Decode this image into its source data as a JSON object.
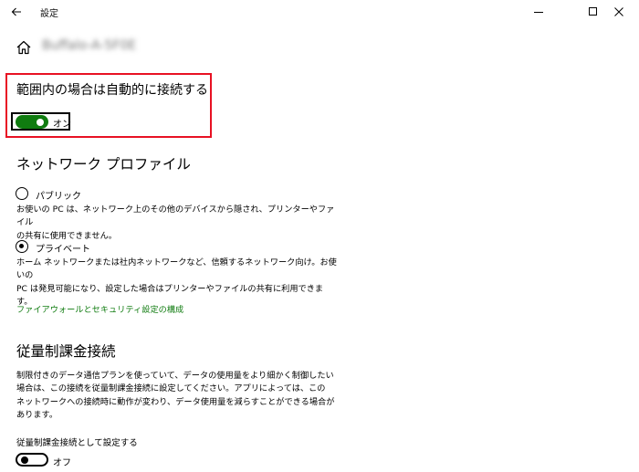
{
  "window": {
    "title": "設定",
    "back_icon": "back-arrow-icon",
    "minimize_icon": "minimize-icon",
    "maximize_icon": "maximize-icon",
    "close_icon": "close-icon"
  },
  "header": {
    "home_icon": "home-icon",
    "network_name": "Buffalo-A-5F0E"
  },
  "auto_connect": {
    "heading": "範囲内の場合は自動的に接続する",
    "toggle_state": "on",
    "toggle_label": "オン"
  },
  "network_profile": {
    "heading": "ネットワーク プロファイル",
    "options": [
      {
        "label": "パブリック",
        "selected": false,
        "description_lines": [
          "お使いの PC は、ネットワーク上のその他のデバイスから隠され、プリンターやファイル",
          "の共有に使用できません。"
        ]
      },
      {
        "label": "プライベート",
        "selected": true,
        "description_lines": [
          "ホーム ネットワークまたは社内ネットワークなど、信頼するネットワーク向け。お使いの",
          "PC は発見可能になり、設定した場合はプリンターやファイルの共有に利用できま",
          "す。"
        ]
      }
    ],
    "firewall_link": "ファイアウォールとセキュリティ設定の構成"
  },
  "metered": {
    "heading": "従量制課金接続",
    "description_lines": [
      "制限付きのデータ通信プランを使っていて、データの使用量をより細かく制御したい",
      "場合は、この接続を従量制課金接続に設定してください。アプリによっては、この",
      "ネットワークへの接続時に動作が変わり、データ使用量を減らすことができる場合が",
      "あります。"
    ],
    "setting_label": "従量制課金接続として設定する",
    "toggle_state": "off",
    "toggle_label": "オフ"
  },
  "colors": {
    "accent": "#107c10",
    "highlight": "#e81123"
  }
}
